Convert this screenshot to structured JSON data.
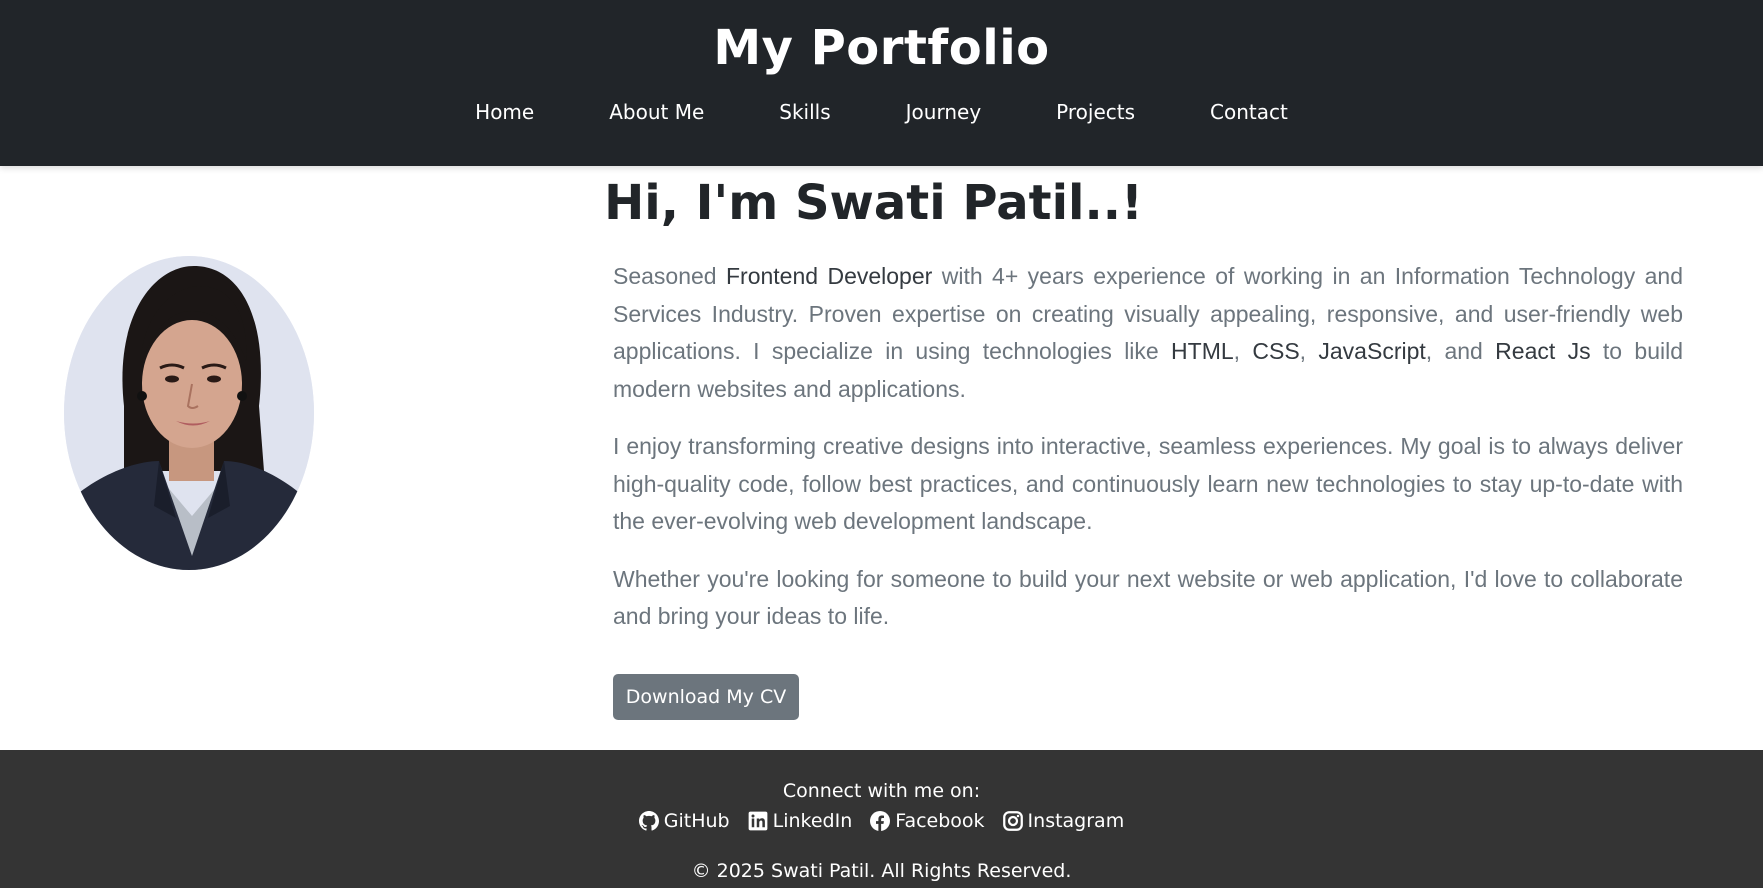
{
  "header": {
    "title": "My Portfolio",
    "nav": [
      "Home",
      "About Me",
      "Skills",
      "Journey",
      "Projects",
      "Contact"
    ]
  },
  "intro": {
    "heading": "Hi, I'm Swati Patil..!",
    "bio": {
      "p1": {
        "t1": "Seasoned ",
        "s1": "Frontend Developer",
        "t2": " with 4+ years experience of working in an Information Technology and Services Industry. Proven expertise on creating visually appealing, responsive, and user-friendly web applications. I specialize in using technologies like ",
        "s2": "HTML",
        "t3": ", ",
        "s3": "CSS",
        "t4": ", ",
        "s4": "JavaScript",
        "t5": ", and ",
        "s5": "React Js",
        "t6": " to build modern websites and applications."
      },
      "p2": "I enjoy transforming creative designs into interactive, seamless experiences. My goal is to always deliver high-quality code, follow best practices, and continuously learn new technologies to stay up-to-date with the ever-evolving web development landscape.",
      "p3": "Whether you're looking for someone to build your next website or web application, I'd love to collaborate and bring your ideas to life."
    },
    "cv_button": "Download My CV"
  },
  "footer": {
    "connect": "Connect with me on:",
    "socials": [
      {
        "label": "GitHub",
        "icon": "github-icon"
      },
      {
        "label": "LinkedIn",
        "icon": "linkedin-icon"
      },
      {
        "label": "Facebook",
        "icon": "facebook-icon"
      },
      {
        "label": "Instagram",
        "icon": "instagram-icon"
      }
    ],
    "copyright": "© 2025 Swati Patil. All Rights Reserved."
  },
  "colors": {
    "header_bg": "#212529",
    "footer_bg": "#343434",
    "button_bg": "#6c757d",
    "body_text": "#6c757d"
  }
}
